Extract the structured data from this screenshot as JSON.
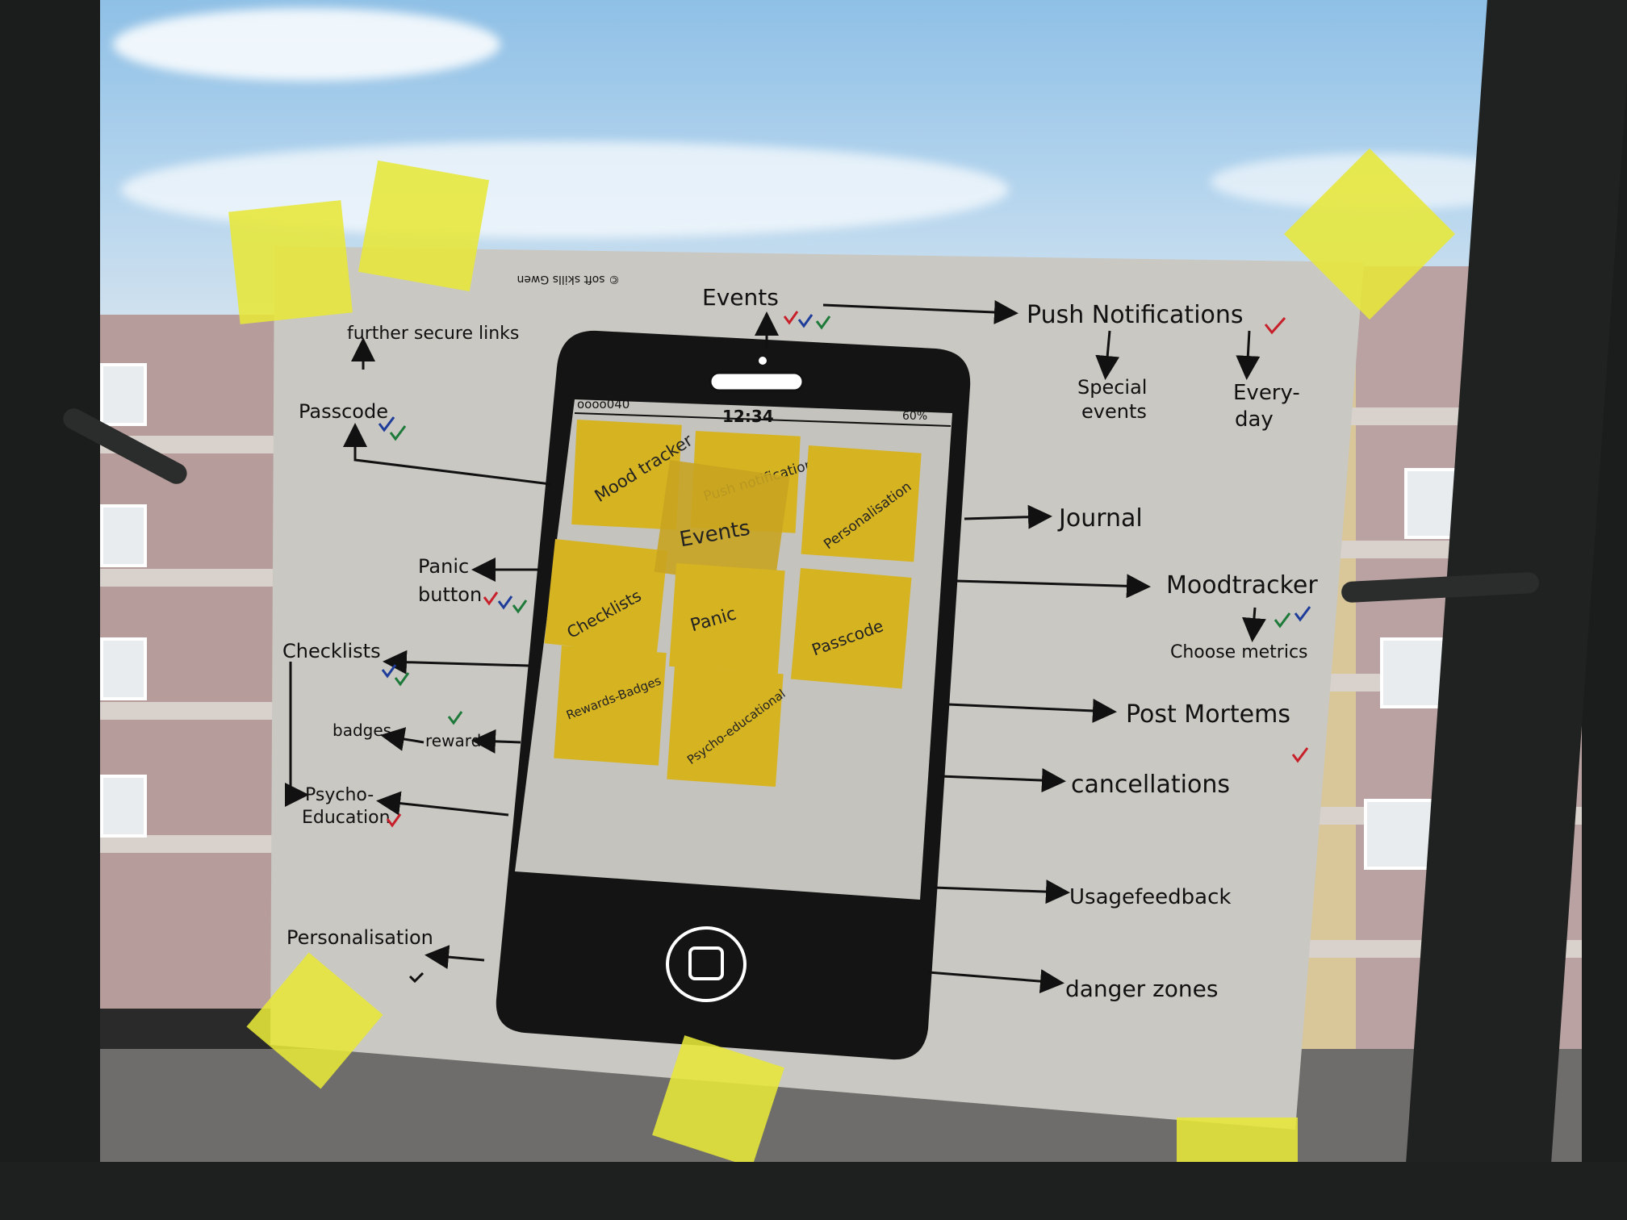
{
  "credit": "© soft skills Gwen",
  "phone": {
    "signal": "oooo040",
    "time": "12:34",
    "battery": "60%"
  },
  "stickies": [
    {
      "label": "Mood tracker"
    },
    {
      "label": "Push notifications"
    },
    {
      "label": "Personalisation"
    },
    {
      "label": "Checklists"
    },
    {
      "label": "Events"
    },
    {
      "label": "Panic"
    },
    {
      "label": "Passcode"
    },
    {
      "label": "Rewards-Badges"
    },
    {
      "label": "Psycho-educational"
    }
  ],
  "left_labels": {
    "further_secure_links": "further secure links",
    "passcode": "Passcode",
    "panic_line1": "Panic",
    "panic_line2": "button",
    "checklists": "Checklists",
    "badges": "badges",
    "rewards": "rewards",
    "psycho_line1": "Psycho-",
    "psycho_line2": "Education",
    "personalisation": "Personalisation"
  },
  "top_labels": {
    "events": "Events",
    "push": "Push Notifications",
    "special_line1": "Special",
    "special_line2": "events",
    "everyday_line1": "Every-",
    "everyday_line2": "day"
  },
  "right_labels": {
    "journal": "Journal",
    "moodtracker": "Moodtracker",
    "choose_metrics": "Choose metrics",
    "post_mortems": "Post Mortems",
    "cancellations": "cancellations",
    "usage_feedback": "Usagefeedback",
    "danger_zones": "danger zones"
  },
  "colors": {
    "poster": "#c9c8c2",
    "ink": "#111111",
    "sticky": "#d8b520",
    "tape": "#e9ea3a",
    "tick_red": "#c8202a",
    "tick_green": "#1e7a3a",
    "tick_blue": "#1e3c9a"
  }
}
